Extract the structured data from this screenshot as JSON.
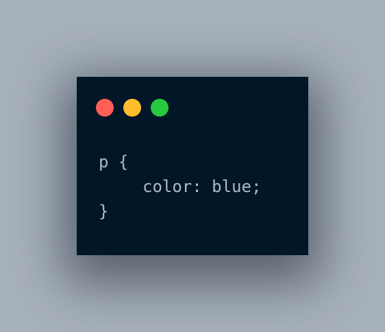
{
  "window": {
    "background_color": "#011627",
    "traffic_lights": [
      {
        "name": "close",
        "color": "#ff5f56"
      },
      {
        "name": "minimize",
        "color": "#ffbd2e"
      },
      {
        "name": "zoom",
        "color": "#27c93f"
      }
    ]
  },
  "code": {
    "lines": [
      "p {",
      "color: blue;",
      "}"
    ],
    "text_color": "#aeb9c7"
  },
  "page": {
    "background_color": "#a7b1bc"
  }
}
